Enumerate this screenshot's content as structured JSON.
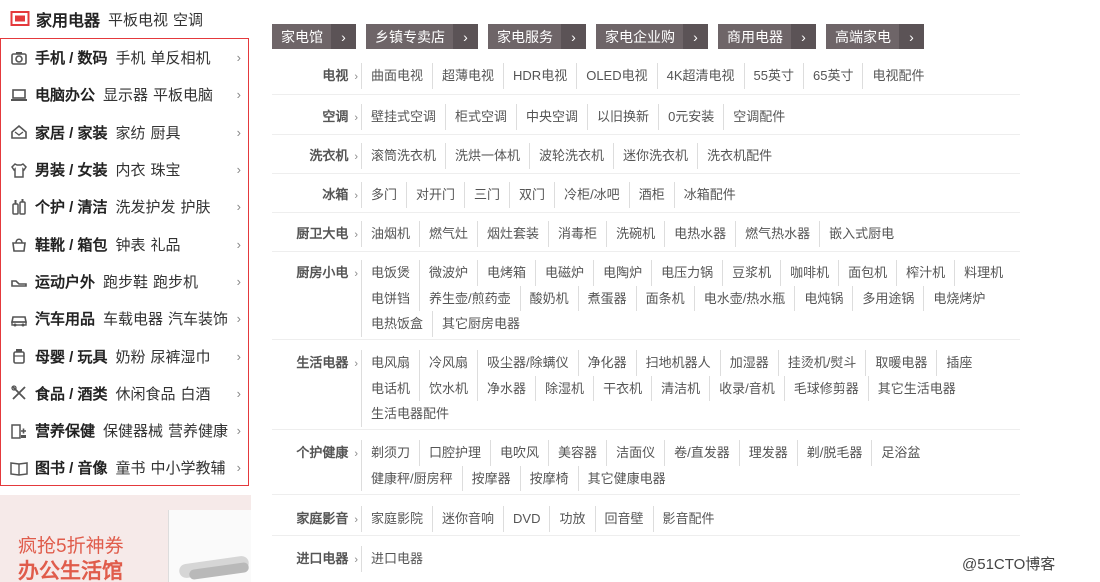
{
  "sidebar": {
    "head": {
      "main": "家用电器",
      "subs": [
        "平板电视",
        "空调"
      ]
    },
    "items": [
      {
        "main": "手机 / 数码",
        "subs": [
          "手机",
          "单反相机"
        ],
        "icon": "camera-icon"
      },
      {
        "main": "电脑办公",
        "subs": [
          "显示器",
          "平板电脑"
        ],
        "icon": "laptop-icon"
      },
      {
        "main": "家居 / 家装",
        "subs": [
          "家纺",
          "厨具"
        ],
        "icon": "home-icon"
      },
      {
        "main": "男装 / 女装",
        "subs": [
          "内衣",
          "珠宝"
        ],
        "icon": "shirt-icon"
      },
      {
        "main": "个护 / 清洁",
        "subs": [
          "洗发护发",
          "护肤"
        ],
        "icon": "bottle-icon"
      },
      {
        "main": "鞋靴 / 箱包",
        "subs": [
          "钟表",
          "礼品"
        ],
        "icon": "bag-icon"
      },
      {
        "main": "运动户外",
        "subs": [
          "跑步鞋",
          "跑步机"
        ],
        "icon": "shoe-icon"
      },
      {
        "main": "汽车用品",
        "subs": [
          "车载电器",
          "汽车装饰"
        ],
        "icon": "car-icon"
      },
      {
        "main": "母婴 / 玩具",
        "subs": [
          "奶粉",
          "尿裤湿巾"
        ],
        "icon": "milk-bottle-icon"
      },
      {
        "main": "食品 / 酒类",
        "subs": [
          "休闲食品",
          "白酒"
        ],
        "icon": "utensils-icon"
      },
      {
        "main": "营养保健",
        "subs": [
          "保健器械",
          "营养健康"
        ],
        "icon": "health-icon"
      },
      {
        "main": "图书 / 音像",
        "subs": [
          "童书",
          "中小学教辅"
        ],
        "icon": "book-icon"
      }
    ],
    "chevron": "›"
  },
  "promo": {
    "line1": "疯抢5折神券",
    "line2": "办公生活馆"
  },
  "tags": [
    "家电馆",
    "乡镇专卖店",
    "家电服务",
    "家电企业购",
    "商用电器",
    "高端家电"
  ],
  "tag_arrow": "›",
  "rows": [
    {
      "label": "电视",
      "items": [
        "曲面电视",
        "超薄电视",
        "HDR电视",
        "OLED电视",
        "4K超清电视",
        "55英寸",
        "65英寸",
        "电视配件"
      ]
    },
    {
      "label": "空调",
      "items": [
        "壁挂式空调",
        "柜式空调",
        "中央空调",
        "以旧换新",
        "0元安装",
        "空调配件"
      ]
    },
    {
      "label": "洗衣机",
      "items": [
        "滚筒洗衣机",
        "洗烘一体机",
        "波轮洗衣机",
        "迷你洗衣机",
        "洗衣机配件"
      ]
    },
    {
      "label": "冰箱",
      "items": [
        "多门",
        "对开门",
        "三门",
        "双门",
        "冷柜/冰吧",
        "酒柜",
        "冰箱配件"
      ]
    },
    {
      "label": "厨卫大电",
      "items": [
        "油烟机",
        "燃气灶",
        "烟灶套装",
        "消毒柜",
        "洗碗机",
        "电热水器",
        "燃气热水器",
        "嵌入式厨电"
      ]
    },
    {
      "label": "厨房小电",
      "items": [
        "电饭煲",
        "微波炉",
        "电烤箱",
        "电磁炉",
        "电陶炉",
        "电压力锅",
        "豆浆机",
        "咖啡机",
        "面包机",
        "榨汁机",
        "料理机",
        "电饼铛",
        "养生壶/煎药壶",
        "酸奶机",
        "煮蛋器",
        "面条机",
        "电水壶/热水瓶",
        "电炖锅",
        "多用途锅",
        "电烧烤炉",
        "电热饭盒",
        "其它厨房电器"
      ]
    },
    {
      "label": "生活电器",
      "items": [
        "电风扇",
        "冷风扇",
        "吸尘器/除螨仪",
        "净化器",
        "扫地机器人",
        "加湿器",
        "挂烫机/熨斗",
        "取暖电器",
        "插座",
        "电话机",
        "饮水机",
        "净水器",
        "除湿机",
        "干衣机",
        "清洁机",
        "收录/音机",
        "毛球修剪器",
        "其它生活电器",
        "生活电器配件"
      ]
    },
    {
      "label": "个护健康",
      "items": [
        "剃须刀",
        "口腔护理",
        "电吹风",
        "美容器",
        "洁面仪",
        "卷/直发器",
        "理发器",
        "剃/脱毛器",
        "足浴盆",
        "健康秤/厨房秤",
        "按摩器",
        "按摩椅",
        "其它健康电器"
      ]
    },
    {
      "label": "家庭影音",
      "items": [
        "家庭影院",
        "迷你音响",
        "DVD",
        "功放",
        "回音壁",
        "影音配件"
      ]
    },
    {
      "label": "进口电器",
      "items": [
        "进口电器"
      ]
    }
  ],
  "row_chevron": "›",
  "watermark": "@51CTO博客",
  "colors": {
    "accent": "#e4393c",
    "tag_bg": "#6e6568",
    "promo_text": "#e05c4b"
  }
}
